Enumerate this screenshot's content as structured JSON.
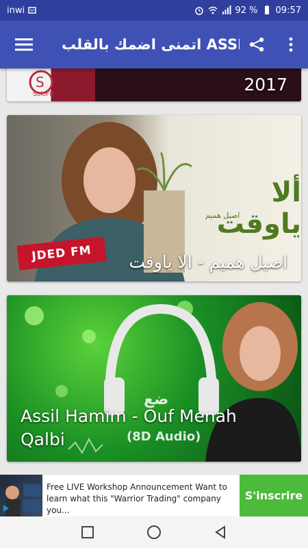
{
  "status_bar": {
    "carrier": "inwi",
    "battery_percent": "92 %",
    "time": "09:57"
  },
  "app_bar": {
    "title": "اتمنى اضمك بالقلب ASSIL"
  },
  "feed": {
    "cards": [
      {
        "caption": "2017",
        "logo_text": "SoloFM"
      },
      {
        "caption": "اصيل هميم - الا ياوقت",
        "overlay_title": "ألا ياوقت",
        "overlay_sub": "اصيل هميم",
        "badge": "JDED FM"
      },
      {
        "caption": "Assil Hamim - Ouf Menah Qalbi",
        "overlay_sub": "(8D Audio)",
        "overlay_logo": "ضع"
      }
    ]
  },
  "ad": {
    "text": "Free LIVE Workshop Announcement Want to learn what this \"Warrior Trading\" company you...",
    "button": "S'inscrire"
  },
  "colors": {
    "status_bar": "#2f3f9e",
    "app_bar": "#3f51b5",
    "ad_button": "#4cbb3b"
  }
}
